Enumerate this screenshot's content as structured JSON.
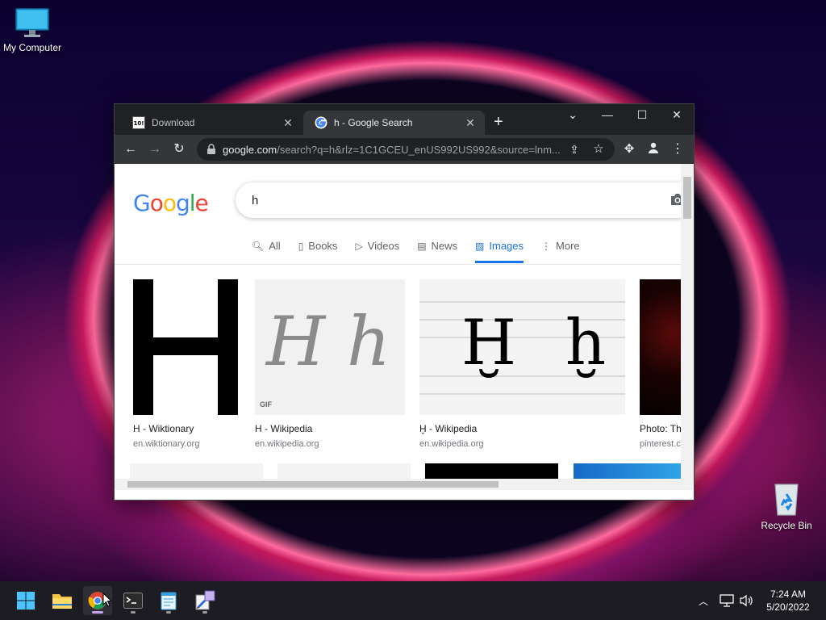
{
  "desktop": {
    "my_computer_label": "My Computer",
    "recycle_bin_label": "Recycle Bin"
  },
  "browser": {
    "tabs": [
      {
        "title": "Download",
        "close": "✕"
      },
      {
        "title": "h - Google Search",
        "close": "✕"
      }
    ],
    "new_tab": "+",
    "window_controls": {
      "dropdown": "⌄",
      "minimize": "—",
      "maximize": "☐",
      "close": "✕"
    },
    "omnibox": {
      "host": "google.com",
      "path": "/search?q=h&rlz=1C1GCEU_enUS992US992&source=lnm..."
    }
  },
  "google": {
    "logo_letters": [
      {
        "ch": "G",
        "color": "#4285F4"
      },
      {
        "ch": "o",
        "color": "#EA4335"
      },
      {
        "ch": "o",
        "color": "#FBBC05"
      },
      {
        "ch": "g",
        "color": "#4285F4"
      },
      {
        "ch": "l",
        "color": "#34A853"
      },
      {
        "ch": "e",
        "color": "#EA4335"
      }
    ],
    "query": "h",
    "tabs": [
      {
        "label": "All",
        "icon": "search-icon"
      },
      {
        "label": "Books",
        "icon": "book-icon"
      },
      {
        "label": "Videos",
        "icon": "video-icon"
      },
      {
        "label": "News",
        "icon": "news-icon"
      },
      {
        "label": "Images",
        "icon": "image-icon",
        "active": true
      },
      {
        "label": "More",
        "icon": "more-vert-icon"
      }
    ],
    "results": [
      {
        "title": "H - Wiktionary",
        "source": "en.wiktionary.org"
      },
      {
        "title": "H - Wikipedia",
        "source": "en.wikipedia.org",
        "badge": "GIF",
        "glyphs": "H h"
      },
      {
        "title": "Ḫ - Wikipedia",
        "source": "en.wikipedia.org",
        "glyphs": "Ḫ ḫ"
      },
      {
        "title": "Photo: Th",
        "source": "pinterest.c"
      }
    ]
  },
  "taskbar": {
    "apps": [
      "start-button",
      "file-explorer",
      "chrome",
      "terminal",
      "notepad",
      "paint"
    ],
    "active_app": "chrome",
    "time": "7:24 AM",
    "date": "5/20/2022"
  },
  "colors": {
    "accent": "#1a73e8",
    "chrome_dark": "#202124",
    "chrome_mid": "#35363a"
  }
}
